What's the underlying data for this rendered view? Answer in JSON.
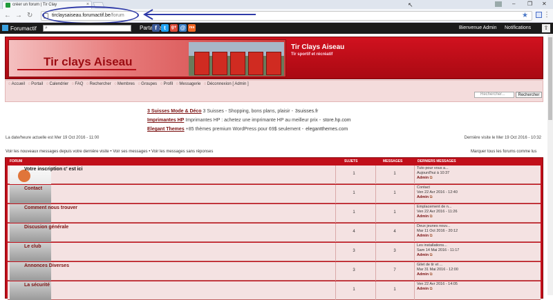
{
  "browser": {
    "tab_title": "créer un forum | Tir Clay",
    "url_host": "tirclaysaiseau.forumactif.be",
    "url_path": "/forum",
    "back_icon": "arrow-left-icon",
    "forward_icon": "arrow-right-icon",
    "reload_icon": "reload-icon"
  },
  "forumactif_bar": {
    "brand": "Forumactif",
    "share_label": "Partagez :",
    "welcome": "Bienvenue Admin",
    "notifications": "Notifications",
    "social": [
      "f",
      "t",
      "g+",
      "@",
      "rss"
    ]
  },
  "header": {
    "banner_text": "Tir clays Aiseau",
    "site_title": "Tir Clays Aiseau",
    "site_subtitle": "Tir sportif et récréatif"
  },
  "navbar": {
    "links": [
      "Accueil",
      "Portail",
      "Calendrier",
      "FAQ",
      "Rechercher",
      "Membres",
      "Groupes",
      "Profil",
      "Messagerie",
      "Déconnexion [ Admin ]"
    ],
    "search_placeholder": "Rechercher...",
    "search_button": "Rechercher"
  },
  "ads": [
    {
      "title": "3 Suisses Mode & Déco",
      "text": "3 Suisses - Shopping, bons plans, plaisir -",
      "domain": "3suisses.fr"
    },
    {
      "title": "Imprimantes HP",
      "text": "Imprimantes HP : achetez une imprimante HP au meilleur prix -",
      "domain": "store.hp.com"
    },
    {
      "title": "Elegant Themes",
      "text": "+85 thèmes premium WordPress pour 69$ seulement -",
      "domain": "elegantthemes.com"
    }
  ],
  "info": {
    "current_time": "La date/heure actuelle est Mer 19 Oct 2016 - 11:00",
    "last_visit": "Dernière visite le Mer 19 Oct 2016 - 10:32",
    "new_since": "Voir les nouveaux messages depuis votre dernière visite",
    "see_own": "Voir ses messages",
    "see_unanswered": "Voir les messages sans réponses",
    "mark_read": "Marquer tous les forums comme lus"
  },
  "forum_table": {
    "headers": {
      "forum": "FORUM",
      "topics": "SUJETS",
      "messages": "MESSAGES",
      "last": "DERNIERS MESSAGES"
    },
    "rows": [
      {
        "name": "Votre inscription c' est ici",
        "topics": "1",
        "messages": "1",
        "last_title": "Tuto pour vous a...",
        "last_date": "Aujourd'hui à 10:37",
        "last_author": "Admin"
      },
      {
        "name": "Contact",
        "topics": "1",
        "messages": "1",
        "last_title": "Contact",
        "last_date": "Ven 22 Avr 2016 - 12:40",
        "last_author": "Admin"
      },
      {
        "name": "Comment nous trouver",
        "topics": "1",
        "messages": "1",
        "last_title": "Emplacement de n...",
        "last_date": "Ven 22 Avr 2016 - 11:26",
        "last_author": "Admin"
      },
      {
        "name": "Discusion générale",
        "topics": "4",
        "messages": "4",
        "last_title": "Deux jeunes nouv...",
        "last_date": "Mar 11 Oct 2016 - 20:12",
        "last_author": "Admin"
      },
      {
        "name": "Le club",
        "topics": "3",
        "messages": "3",
        "last_title": "Les installations...",
        "last_date": "Sam 14 Mai 2016 - 11:17",
        "last_author": "Admin"
      },
      {
        "name": "Annonces Diverses",
        "topics": "3",
        "messages": "7",
        "last_title": "Gilet de tir et ...",
        "last_date": "Mar 31 Mai 2016 - 12:00",
        "last_author": "Admin"
      },
      {
        "name": "La sécurité",
        "topics": "1",
        "messages": "1",
        "last_title": "",
        "last_date": "Ven 22 Avr 2016 - 14:05",
        "last_author": "Admin"
      }
    ]
  }
}
